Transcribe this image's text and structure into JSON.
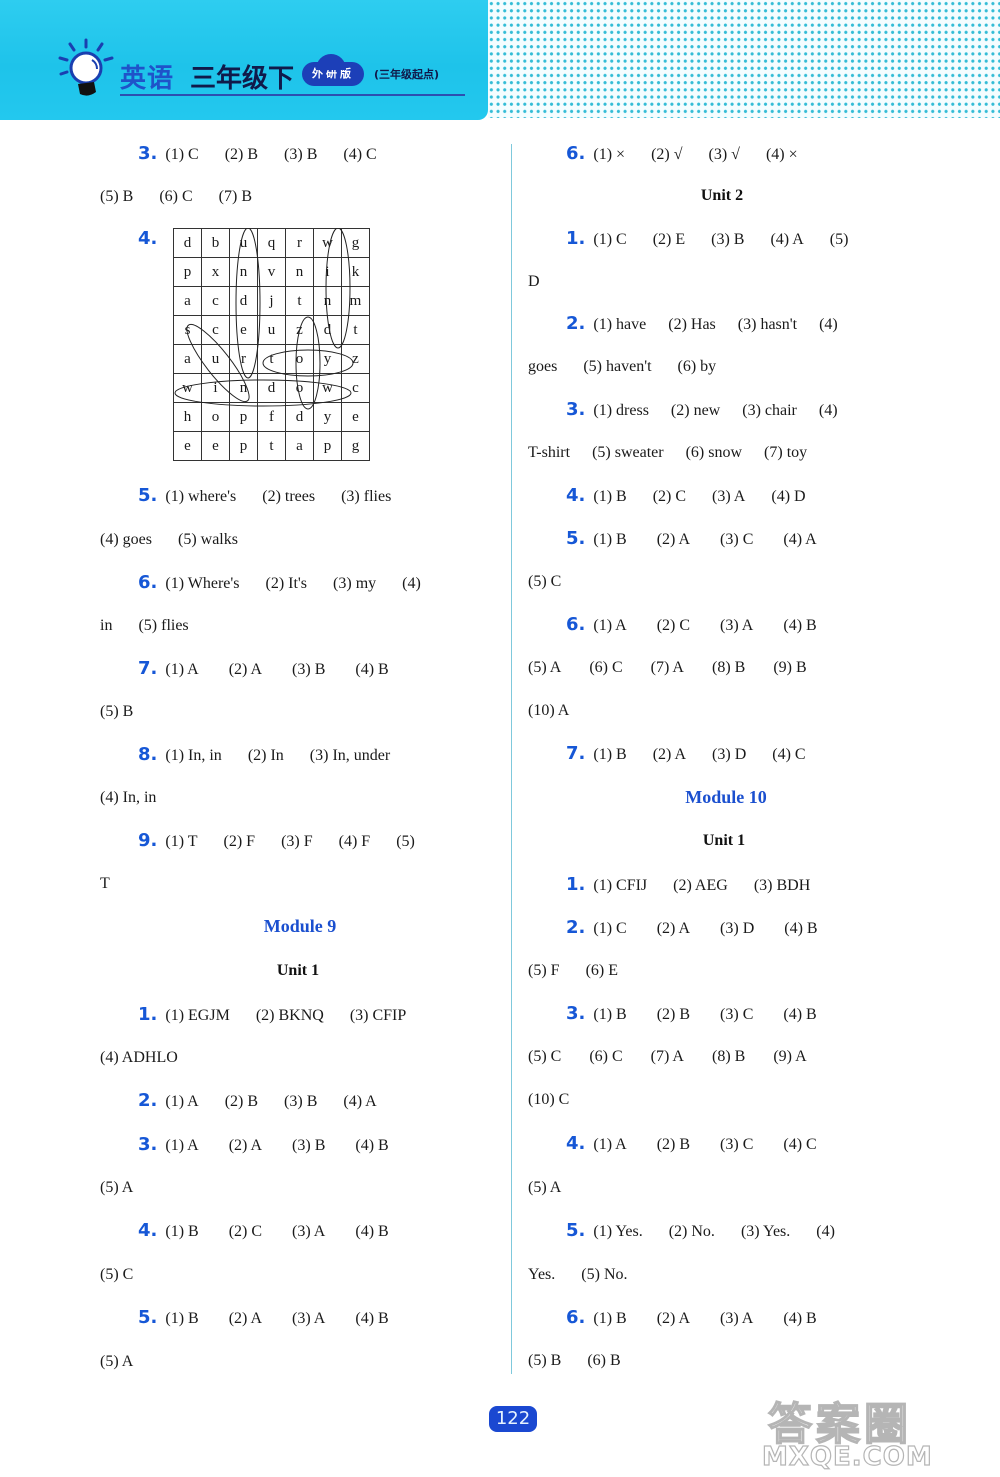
{
  "header": {
    "subject": "英语",
    "grade": "三年级下",
    "edition": "外研版",
    "start_point": "(三年级起点)"
  },
  "left_column": {
    "q3": {
      "num": "3.",
      "line1": [
        "(1) C",
        "(2) B",
        "(3) B",
        "(4) C"
      ],
      "line2": [
        "(5) B",
        "(6) C",
        "(7) B"
      ]
    },
    "q4": {
      "num": "4.",
      "grid": [
        [
          "d",
          "b",
          "u",
          "q",
          "r",
          "w",
          "g"
        ],
        [
          "p",
          "x",
          "n",
          "v",
          "n",
          "i",
          "k"
        ],
        [
          "a",
          "c",
          "d",
          "j",
          "t",
          "n",
          "m"
        ],
        [
          "s",
          "c",
          "e",
          "u",
          "z",
          "d",
          "t"
        ],
        [
          "a",
          "u",
          "r",
          "t",
          "o",
          "y",
          "z"
        ],
        [
          "w",
          "i",
          "n",
          "d",
          "o",
          "w",
          "c"
        ],
        [
          "h",
          "o",
          "p",
          "f",
          "d",
          "y",
          "e"
        ],
        [
          "e",
          "e",
          "p",
          "t",
          "a",
          "p",
          "g"
        ]
      ],
      "circled_words": [
        "under",
        "wind",
        "sun",
        "toy",
        "zoo",
        "window"
      ]
    },
    "q5": {
      "num": "5.",
      "line1": [
        "(1) where's",
        "(2) trees",
        "(3) flies"
      ],
      "line2": [
        "(4) goes",
        "(5) walks"
      ]
    },
    "q6": {
      "num": "6.",
      "line1": [
        "(1) Where's",
        "(2) It's",
        "(3) my",
        "(4)"
      ],
      "line2": [
        "in",
        "(5) flies"
      ]
    },
    "q7": {
      "num": "7.",
      "line1": [
        "(1) A",
        "(2) A",
        "(3) B",
        "(4) B"
      ],
      "line2": [
        "(5) B"
      ]
    },
    "q8": {
      "num": "8.",
      "line1": [
        "(1) In, in",
        "(2) In",
        "(3) In, under"
      ],
      "line2": [
        "(4) In, in"
      ]
    },
    "q9": {
      "num": "9.",
      "line1": [
        "(1) T",
        "(2) F",
        "(3) F",
        "(4) F",
        "(5)"
      ],
      "line2": [
        "T"
      ]
    },
    "module9": {
      "title": "Module 9",
      "unit": "Unit 1",
      "q1": {
        "num": "1.",
        "line1": [
          "(1) EGJM",
          "(2) BKNQ",
          "(3) CFIP"
        ],
        "line2": [
          "(4) ADHLO"
        ]
      },
      "q2": {
        "num": "2.",
        "line1": [
          "(1) A",
          "(2) B",
          "(3) B",
          "(4) A"
        ]
      },
      "q3": {
        "num": "3.",
        "line1": [
          "(1) A",
          "(2) A",
          "(3) B",
          "(4) B"
        ],
        "line2": [
          "(5) A"
        ]
      },
      "q4": {
        "num": "4.",
        "line1": [
          "(1) B",
          "(2) C",
          "(3) A",
          "(4) B"
        ],
        "line2": [
          "(5) C"
        ]
      },
      "q5": {
        "num": "5.",
        "line1": [
          "(1) B",
          "(2) A",
          "(3) A",
          "(4) B"
        ],
        "line2": [
          "(5) A"
        ]
      }
    }
  },
  "right_column": {
    "q6": {
      "num": "6.",
      "line1": [
        "(1) ×",
        "(2) √",
        "(3) √",
        "(4) ×"
      ]
    },
    "unit2": {
      "title": "Unit 2",
      "q1": {
        "num": "1.",
        "line1": [
          "(1) C",
          "(2) E",
          "(3) B",
          "(4) A",
          "(5)"
        ],
        "line2": [
          "D"
        ]
      },
      "q2": {
        "num": "2.",
        "line1": [
          "(1) have",
          "(2) Has",
          "(3) hasn't",
          "(4)"
        ],
        "line2": [
          "goes",
          "(5) haven't",
          "(6) by"
        ]
      },
      "q3": {
        "num": "3.",
        "line1": [
          "(1) dress",
          "(2) new",
          "(3) chair",
          "(4)"
        ],
        "line2": [
          "T-shirt",
          "(5) sweater",
          "(6) snow",
          "(7) toy"
        ]
      },
      "q4": {
        "num": "4.",
        "line1": [
          "(1) B",
          "(2) C",
          "(3) A",
          "(4) D"
        ]
      },
      "q5": {
        "num": "5.",
        "line1": [
          "(1) B",
          "(2) A",
          "(3) C",
          "(4) A"
        ],
        "line2": [
          "(5) C"
        ]
      },
      "q6": {
        "num": "6.",
        "line1": [
          "(1) A",
          "(2) C",
          "(3) A",
          "(4) B"
        ],
        "line2": [
          "(5) A",
          "(6) C",
          "(7) A",
          "(8) B",
          "(9) B"
        ],
        "line3": [
          "(10) A"
        ]
      },
      "q7": {
        "num": "7.",
        "line1": [
          "(1) B",
          "(2) A",
          "(3) D",
          "(4) C"
        ]
      }
    },
    "module10": {
      "title": "Module 10",
      "unit": "Unit 1",
      "q1": {
        "num": "1.",
        "line1": [
          "(1) CFIJ",
          "(2) AEG",
          "(3) BDH"
        ]
      },
      "q2": {
        "num": "2.",
        "line1": [
          "(1) C",
          "(2) A",
          "(3) D",
          "(4) B"
        ],
        "line2": [
          "(5) F",
          "(6) E"
        ]
      },
      "q3": {
        "num": "3.",
        "line1": [
          "(1) B",
          "(2) B",
          "(3) C",
          "(4) B"
        ],
        "line2": [
          "(5) C",
          "(6) C",
          "(7) A",
          "(8) B",
          "(9) A"
        ],
        "line3": [
          "(10) C"
        ]
      },
      "q4": {
        "num": "4.",
        "line1": [
          "(1) A",
          "(2) B",
          "(3) C",
          "(4) C"
        ],
        "line2": [
          "(5) A"
        ]
      },
      "q5": {
        "num": "5.",
        "line1": [
          "(1) Yes.",
          "(2) No.",
          "(3) Yes.",
          "(4)"
        ],
        "line2": [
          "Yes.",
          "(5) No."
        ]
      },
      "q6": {
        "num": "6.",
        "line1": [
          "(1) B",
          "(2) A",
          "(3) A",
          "(4) B"
        ],
        "line2": [
          "(5) B",
          "(6) B"
        ]
      }
    }
  },
  "footer": {
    "page_number": "122",
    "watermark_top": "答案圈",
    "watermark_bottom": "MXQE.COM"
  },
  "colors": {
    "banner": "#1ec3ea",
    "accent_blue": "#1657d6",
    "module_heading": "#1a4fcf",
    "page_badge": "#1a48d1"
  }
}
